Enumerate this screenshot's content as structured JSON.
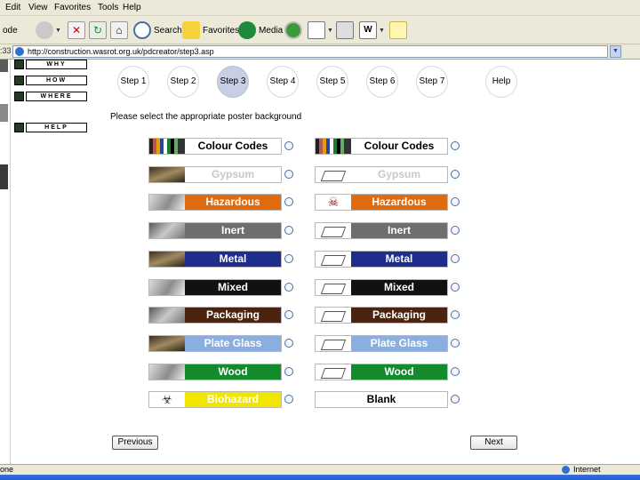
{
  "browser": {
    "menu": [
      "Edit",
      "View",
      "Favorites",
      "Tools",
      "Help"
    ],
    "toolbar": {
      "search_label": "Search",
      "favorites_label": "Favorites",
      "media_label": "Media",
      "cut_left_label": "ode"
    },
    "address": {
      "prefix": ":33",
      "url": "http://construction.wasrot.org.uk/pdcreator/step3.asp"
    },
    "status": {
      "left": "one",
      "zone": "Internet"
    }
  },
  "sidebar": {
    "items": [
      "WHY",
      "HOW",
      "WHERE",
      "HELP"
    ]
  },
  "steps": [
    "Step 1",
    "Step 2",
    "Step 3",
    "Step 4",
    "Step 5",
    "Step 6",
    "Step 7",
    "Help"
  ],
  "active_step": "Step 3",
  "instruction": "Please select the appropriate poster background",
  "options_left": [
    {
      "label": "Colour Codes",
      "color": "#ffffff",
      "text_color": "#000000",
      "thumb": "stripes"
    },
    {
      "label": "Gypsum",
      "color": "#ffffff",
      "text_color": "#c8c8c8",
      "thumb": "photo"
    },
    {
      "label": "Hazardous",
      "color": "#e06a0e",
      "text_color": "#ffffff",
      "thumb": "photo"
    },
    {
      "label": "Inert",
      "color": "#6e6e6e",
      "text_color": "#ffffff",
      "thumb": "photo"
    },
    {
      "label": "Metal",
      "color": "#1f2d8c",
      "text_color": "#ffffff",
      "thumb": "photo"
    },
    {
      "label": "Mixed",
      "color": "#111111",
      "text_color": "#ffffff",
      "thumb": "photo"
    },
    {
      "label": "Packaging",
      "color": "#4a2410",
      "text_color": "#ffffff",
      "thumb": "photo"
    },
    {
      "label": "Plate Glass",
      "color": "#8aaee0",
      "text_color": "#ffffff",
      "thumb": "photo"
    },
    {
      "label": "Wood",
      "color": "#138a2b",
      "text_color": "#ffffff",
      "thumb": "photo"
    },
    {
      "label": "Biohazard",
      "color": "#f2e600",
      "text_color": "#ffffff",
      "thumb": "biohazard"
    }
  ],
  "options_right": [
    {
      "label": "Colour Codes",
      "color": "#ffffff",
      "text_color": "#000000",
      "thumb": "stripes"
    },
    {
      "label": "Gypsum",
      "color": "#ffffff",
      "text_color": "#c8c8c8",
      "thumb": "lineart"
    },
    {
      "label": "Hazardous",
      "color": "#e06a0e",
      "text_color": "#ffffff",
      "thumb": "skull"
    },
    {
      "label": "Inert",
      "color": "#6e6e6e",
      "text_color": "#ffffff",
      "thumb": "lineart"
    },
    {
      "label": "Metal",
      "color": "#1f2d8c",
      "text_color": "#ffffff",
      "thumb": "lineart"
    },
    {
      "label": "Mixed",
      "color": "#111111",
      "text_color": "#ffffff",
      "thumb": "lineart"
    },
    {
      "label": "Packaging",
      "color": "#4a2410",
      "text_color": "#ffffff",
      "thumb": "lineart"
    },
    {
      "label": "Plate Glass",
      "color": "#8aaee0",
      "text_color": "#ffffff",
      "thumb": "lineart"
    },
    {
      "label": "Wood",
      "color": "#138a2b",
      "text_color": "#ffffff",
      "thumb": "lineart"
    },
    {
      "label": "Blank",
      "color": "#ffffff",
      "text_color": "#000000",
      "thumb": "none"
    }
  ],
  "buttons": {
    "previous": "Previous",
    "next": "Next"
  }
}
